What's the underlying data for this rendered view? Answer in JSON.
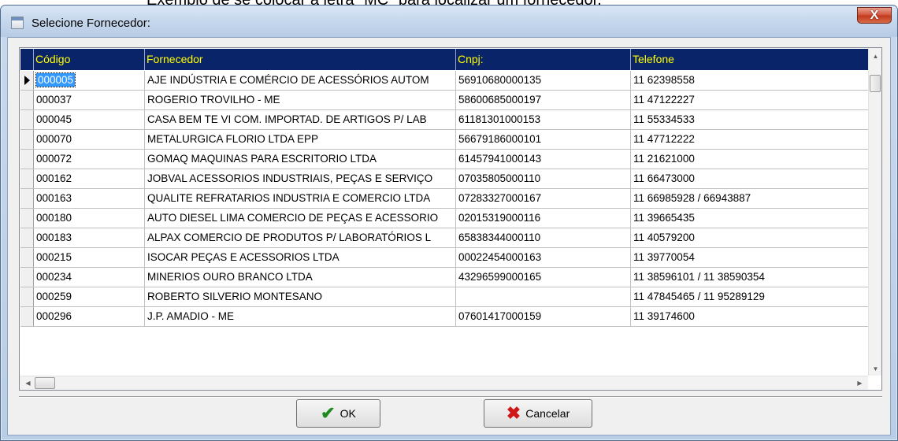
{
  "background_caption": "Exemplo de se colocar a letra \"MC\" para localizar um fornecedor.",
  "window": {
    "title": "Selecione Fornecedor:",
    "close_label": "X"
  },
  "table": {
    "columns": [
      "Código",
      "Fornecedor",
      "Cnpj:",
      "Telefone"
    ],
    "selected_row": 0,
    "rows": [
      {
        "codigo": "000005",
        "fornecedor": "AJE INDÚSTRIA E COMÉRCIO DE ACESSÓRIOS AUTOM",
        "cnpj": "56910680000135",
        "telefone": "11 62398558"
      },
      {
        "codigo": "000037",
        "fornecedor": "ROGERIO TROVILHO - ME",
        "cnpj": "58600685000197",
        "telefone": "11 47122227"
      },
      {
        "codigo": "000045",
        "fornecedor": "CASA BEM TE VI COM. IMPORTAD. DE ARTIGOS P/ LAB",
        "cnpj": "61181301000153",
        "telefone": "11 55334533"
      },
      {
        "codigo": "000070",
        "fornecedor": "METALURGICA FLORIO LTDA EPP",
        "cnpj": "56679186000101",
        "telefone": "11 47712222"
      },
      {
        "codigo": "000072",
        "fornecedor": "GOMAQ MAQUINAS PARA ESCRITORIO LTDA",
        "cnpj": "61457941000143",
        "telefone": "11 21621000"
      },
      {
        "codigo": "000162",
        "fornecedor": "JOBVAL ACESSORIOS INDUSTRIAIS, PEÇAS E SERVIÇO",
        "cnpj": "07035805000110",
        "telefone": "11 66473000"
      },
      {
        "codigo": "000163",
        "fornecedor": "QUALITE REFRATARIOS INDUSTRIA E COMERCIO LTDA",
        "cnpj": "07283327000167",
        "telefone": "11 66985928 / 66943887"
      },
      {
        "codigo": "000180",
        "fornecedor": "AUTO DIESEL LIMA COMERCIO DE PEÇAS E ACESSORIO",
        "cnpj": "02015319000116",
        "telefone": "11 39665435"
      },
      {
        "codigo": "000183",
        "fornecedor": "ALPAX COMERCIO  DE PRODUTOS P/ LABORATÓRIOS L",
        "cnpj": "65838344000110",
        "telefone": "11 40579200"
      },
      {
        "codigo": "000215",
        "fornecedor": "ISOCAR PEÇAS E ACESSORIOS LTDA",
        "cnpj": "00022454000163",
        "telefone": "11 39770054"
      },
      {
        "codigo": "000234",
        "fornecedor": "MINERIOS OURO BRANCO LTDA",
        "cnpj": "43296599000165",
        "telefone": "11 38596101 / 11 38590354"
      },
      {
        "codigo": "000259",
        "fornecedor": "ROBERTO SILVERIO MONTESANO",
        "cnpj": "",
        "telefone": "11 47845465 / 11 95289129"
      },
      {
        "codigo": "000296",
        "fornecedor": "J.P. AMADIO - ME",
        "cnpj": "07601417000159",
        "telefone": "11 39174600"
      }
    ]
  },
  "buttons": {
    "ok_label": "OK",
    "cancel_label": "Cancelar"
  },
  "icons": {
    "ok": "checkmark-icon",
    "cancel": "x-icon"
  },
  "colors": {
    "header_bg": "#0a246a",
    "header_text": "#ffff00",
    "selection": "#3399ff"
  }
}
